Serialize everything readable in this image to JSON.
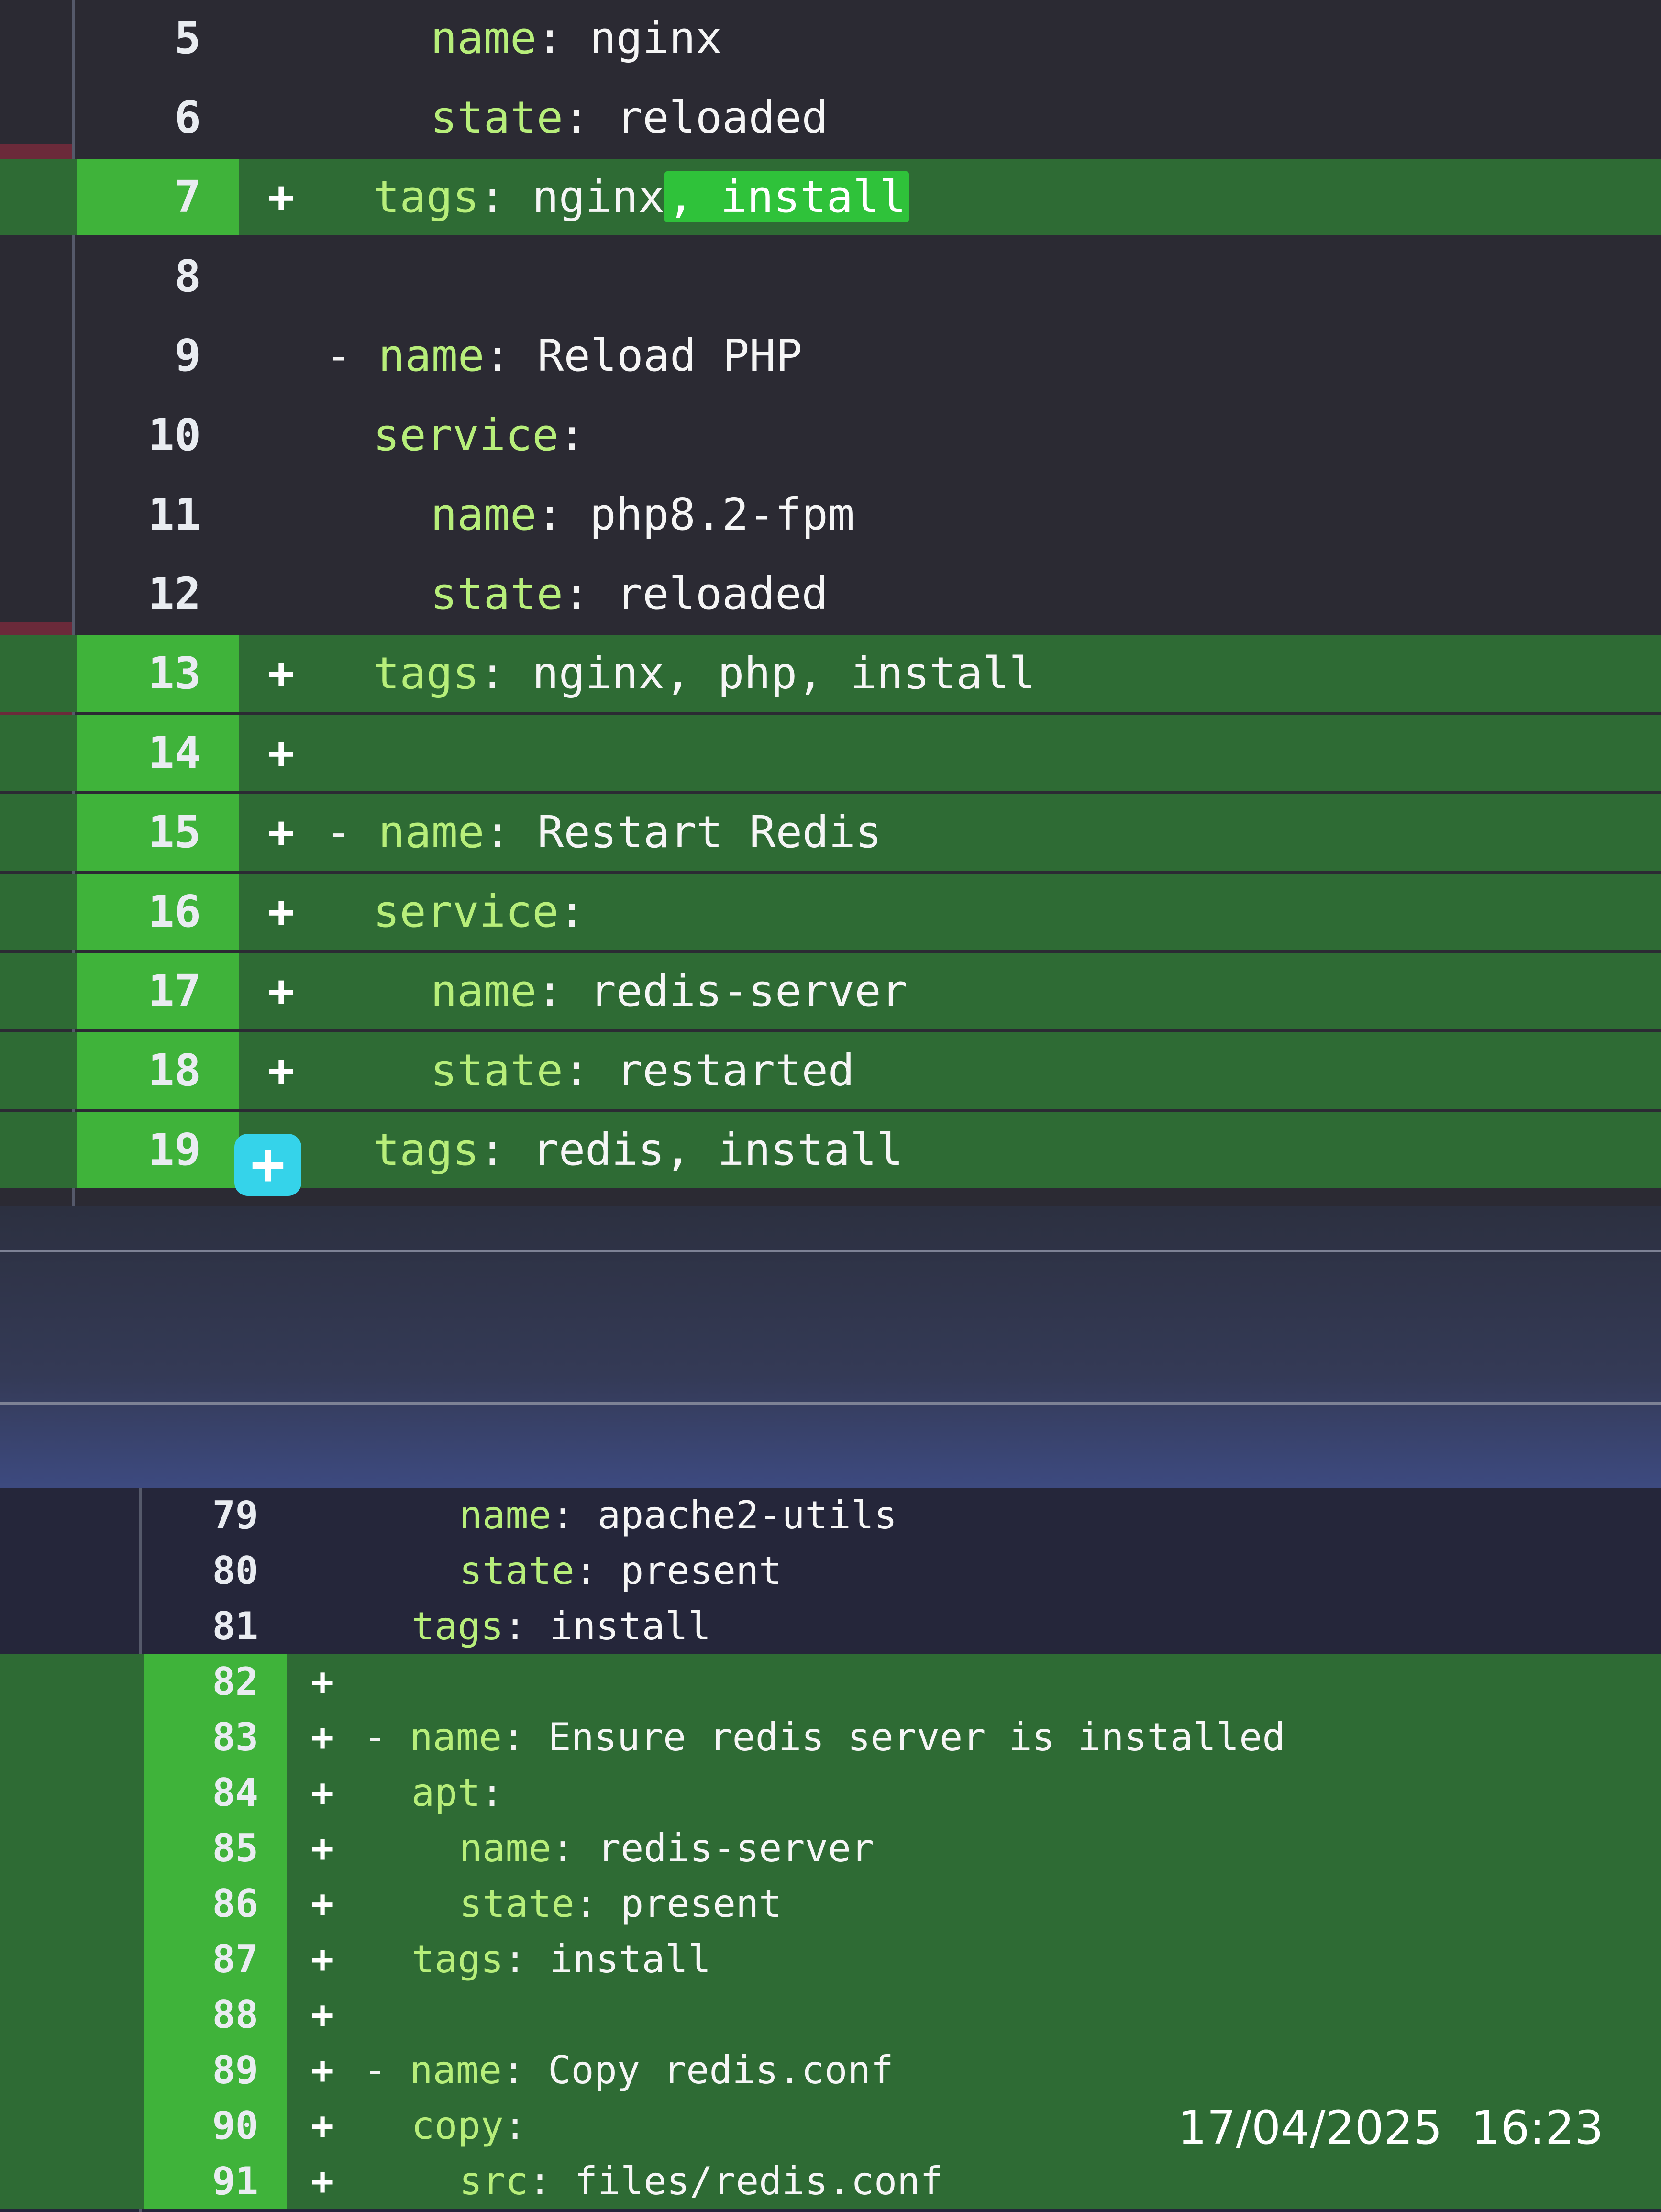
{
  "top_hunk": {
    "rows": [
      {
        "line": "5",
        "marker": "",
        "key": "name",
        "value": "nginx",
        "pre": "",
        "highlight": ""
      },
      {
        "line": "6",
        "marker": "",
        "key": "state",
        "value": "reloaded",
        "pre": "",
        "highlight": ""
      },
      {
        "line": "7",
        "marker": "+",
        "key": "tags",
        "value": "nginx",
        "pre": "",
        "highlight": ", install"
      },
      {
        "line": "8",
        "marker": "",
        "key": "",
        "value": "",
        "pre": "",
        "highlight": ""
      },
      {
        "line": "9",
        "marker": "",
        "key": "name",
        "value": "Reload PHP",
        "pre": "- ",
        "highlight": ""
      },
      {
        "line": "10",
        "marker": "",
        "key": "service",
        "value": "",
        "pre": "",
        "highlight": ""
      },
      {
        "line": "11",
        "marker": "",
        "key": "name",
        "value": "php8.2-fpm",
        "pre": "",
        "highlight": ""
      },
      {
        "line": "12",
        "marker": "",
        "key": "state",
        "value": "reloaded",
        "pre": "",
        "highlight": ""
      },
      {
        "line": "13",
        "marker": "+",
        "key": "tags",
        "value": "nginx, php, install",
        "pre": "",
        "highlight": ""
      },
      {
        "line": "14",
        "marker": "+",
        "key": "",
        "value": "",
        "pre": "",
        "highlight": ""
      },
      {
        "line": "15",
        "marker": "+",
        "key": "name",
        "value": "Restart Redis",
        "pre": "- ",
        "highlight": ""
      },
      {
        "line": "16",
        "marker": "+",
        "key": "service",
        "value": "",
        "pre": "",
        "highlight": ""
      },
      {
        "line": "17",
        "marker": "+",
        "key": "name",
        "value": "redis-server",
        "pre": "",
        "highlight": ""
      },
      {
        "line": "18",
        "marker": "+",
        "key": "state",
        "value": "restarted",
        "pre": "",
        "highlight": ""
      },
      {
        "line": "19",
        "marker": "+",
        "key": "tags",
        "value": "redis, install",
        "pre": "",
        "highlight": ""
      }
    ]
  },
  "bottom_hunk": {
    "rows": [
      {
        "line": "79",
        "marker": "",
        "key": "name",
        "value": "apache2-utils",
        "pre": ""
      },
      {
        "line": "80",
        "marker": "",
        "key": "state",
        "value": "present",
        "pre": ""
      },
      {
        "line": "81",
        "marker": "",
        "key": "tags",
        "value": "install",
        "pre": ""
      },
      {
        "line": "82",
        "marker": "+",
        "key": "",
        "value": "",
        "pre": ""
      },
      {
        "line": "83",
        "marker": "+",
        "key": "name",
        "value": "Ensure redis server is installed",
        "pre": "- "
      },
      {
        "line": "84",
        "marker": "+",
        "key": "apt",
        "value": "",
        "pre": ""
      },
      {
        "line": "85",
        "marker": "+",
        "key": "name",
        "value": "redis-server",
        "pre": ""
      },
      {
        "line": "86",
        "marker": "+",
        "key": "state",
        "value": "present",
        "pre": ""
      },
      {
        "line": "87",
        "marker": "+",
        "key": "tags",
        "value": "install",
        "pre": ""
      },
      {
        "line": "88",
        "marker": "+",
        "key": "",
        "value": "",
        "pre": ""
      },
      {
        "line": "89",
        "marker": "+",
        "key": "name",
        "value": "Copy redis.conf",
        "pre": "- "
      },
      {
        "line": "90",
        "marker": "+",
        "key": "copy",
        "value": "",
        "pre": ""
      },
      {
        "line": "91",
        "marker": "+",
        "key": "src",
        "value": "files/redis.conf",
        "pre": ""
      }
    ]
  },
  "comment_button": {
    "icon": "plus-icon",
    "glyph": "+"
  },
  "timestamp": "17/04/2025 16:23",
  "colors": {
    "added_bg": "#2e6b34",
    "added_gutter": "#3fb33a",
    "key": "#b7ee7a",
    "comment_button": "#35d3ea"
  }
}
